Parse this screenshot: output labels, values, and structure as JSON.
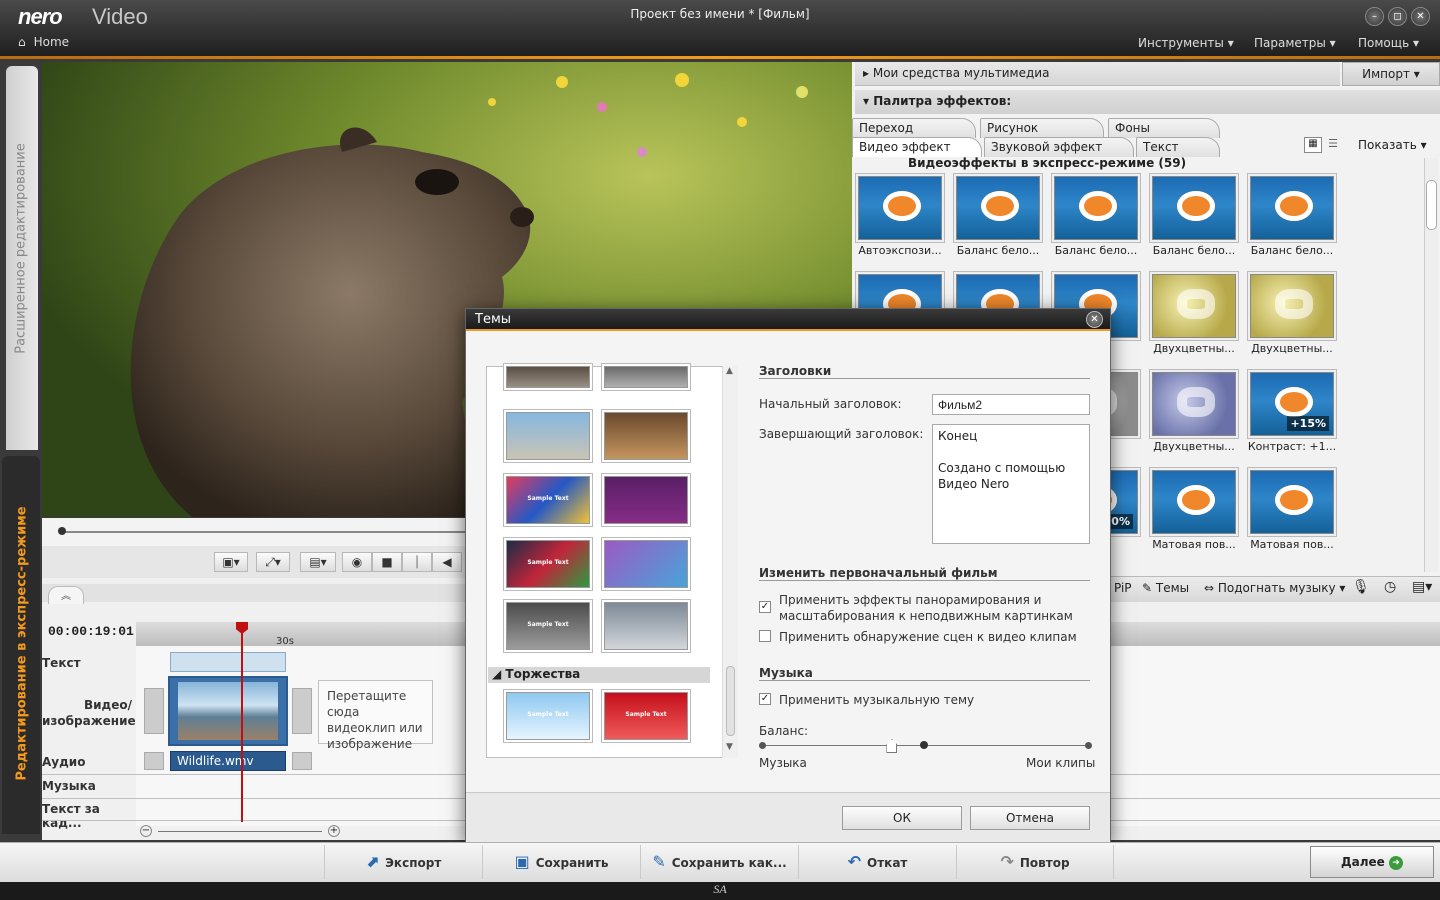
{
  "app": {
    "logo": "nero",
    "product": "Video",
    "window_title": "Проект без имени * [Фильм]",
    "home": "Home"
  },
  "menu": [
    "Инструменты ▾",
    "Параметры ▾",
    "Помощь ▾"
  ],
  "left_tabs": {
    "advanced": "Расширенное редактирование",
    "express": "Редактирование в экспресс-режиме"
  },
  "timeline": {
    "time": "00:00:19:01",
    "ruler_label": "30s",
    "tracks": [
      "Текст",
      "Видео/\nизображение",
      "Аудио",
      "Музыка",
      "Текст за кад..."
    ],
    "drop_hint": "Перетащите сюда видеоклип или изображение",
    "audio_clip": "Wildlife.wmv"
  },
  "right_panel": {
    "media_header": "Мои средства мультимедиа",
    "import": "Импорт ▾",
    "effects_header": "Палитра эффектов:",
    "tabs_row1": [
      "Переход",
      "Рисунок",
      "Фоны"
    ],
    "tabs_row2": [
      "Видео эффект",
      "Звуковой эффект",
      "Текст"
    ],
    "show": "Показать ▾",
    "grid_title": "Видеоэффекты в экспресс-режиме (59)",
    "effects": [
      {
        "label": "Автоэкспози...",
        "style": "fish"
      },
      {
        "label": "Баланс бело...",
        "style": "fish"
      },
      {
        "label": "Баланс бело...",
        "style": "fish"
      },
      {
        "label": "Баланс бело...",
        "style": "fish"
      },
      {
        "label": "Баланс бело...",
        "style": "fish"
      },
      {
        "label": "",
        "style": "fish"
      },
      {
        "label": "",
        "style": "fish"
      },
      {
        "label": "ело...",
        "style": "fish"
      },
      {
        "label": "Двухцветны...",
        "style": "gear"
      },
      {
        "label": "Двухцветны...",
        "style": "gear"
      },
      {
        "label": "",
        "style": "gray"
      },
      {
        "label": "",
        "style": "gray"
      },
      {
        "label": "ны...",
        "style": "gray"
      },
      {
        "label": "Двухцветны...",
        "style": "gearb"
      },
      {
        "label": "Контраст: +1...",
        "style": "fish",
        "tag": "+15%"
      },
      {
        "label": "",
        "style": "fish"
      },
      {
        "label": "",
        "style": "fish"
      },
      {
        "label": "-3...",
        "style": "fish",
        "tag": "30%"
      },
      {
        "label": "Матовая пов...",
        "style": "fish"
      },
      {
        "label": "Матовая пов...",
        "style": "fish"
      }
    ],
    "toolbar": {
      "pip": "PiP",
      "themes": "Темы",
      "fit_music": "Подогнать музыку ▾"
    }
  },
  "dialog": {
    "title": "Темы",
    "category": "Торжества",
    "titles_section": "Заголовки",
    "opening_label": "Начальный заголовок:",
    "opening_value": "Фильм2",
    "closing_label": "Завершающий заголовок:",
    "closing_line1": "Конец",
    "closing_line2": "Создано с помощью",
    "closing_line3": "Видео Nero",
    "modify_section": "Изменить первоначальный фильм",
    "opt1": "Применить эффекты панорамирования и масштабирования к неподвижным картинкам",
    "opt1_checked": true,
    "opt2": "Применить обнаружение сцен к видео клипам",
    "opt2_checked": false,
    "music_section": "Музыка",
    "opt3": "Применить музыкальную тему",
    "opt3_checked": true,
    "balance_label": "Баланс:",
    "balance_left": "Музыка",
    "balance_right": "Мои клипы",
    "balance_value": 0.4,
    "theme_sample": "Sample Text",
    "ok": "ОК",
    "cancel": "Отмена"
  },
  "bottom": {
    "export": "Экспорт",
    "save": "Сохранить",
    "save_as": "Сохранить как...",
    "undo": "Откат",
    "redo": "Повтор",
    "next": "Далее"
  },
  "status": "SA"
}
